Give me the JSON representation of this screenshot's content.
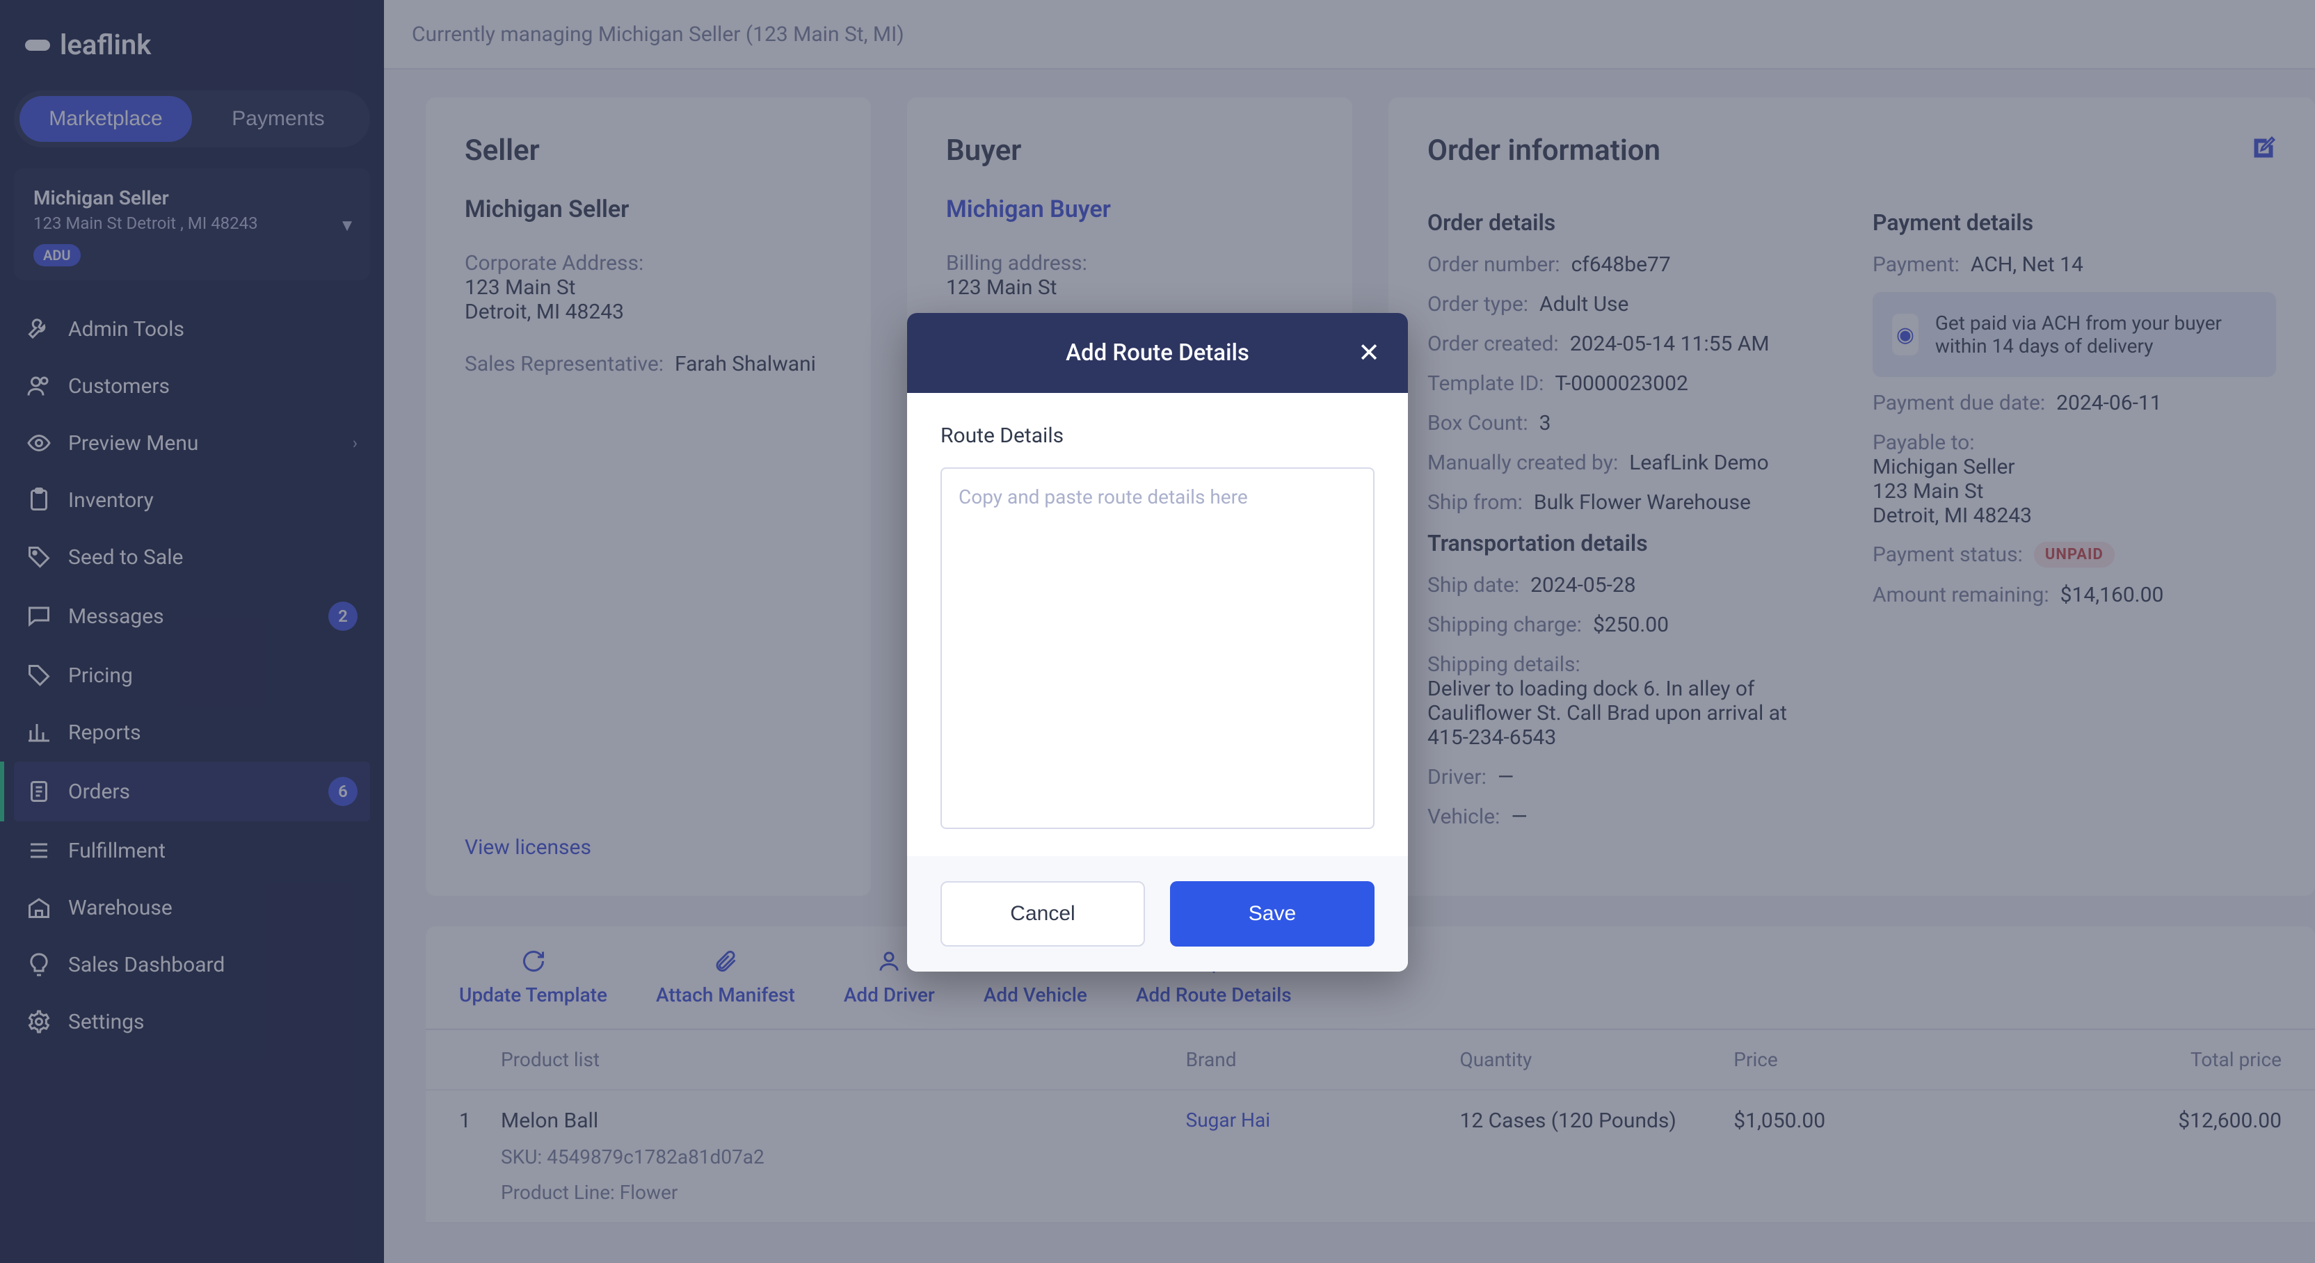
{
  "brand": "leaflink",
  "topbar": {
    "context": "Currently managing Michigan Seller (123 Main St, MI)"
  },
  "segmented": {
    "marketplace": "Marketplace",
    "payments": "Payments"
  },
  "org_card": {
    "name": "Michigan Seller",
    "address": "123 Main St Detroit , MI 48243",
    "badge": "ADU"
  },
  "nav": {
    "admin_tools": "Admin Tools",
    "customers": "Customers",
    "preview_menu": "Preview Menu",
    "inventory": "Inventory",
    "seed_to_sale": "Seed to Sale",
    "messages": "Messages",
    "messages_count": "2",
    "pricing": "Pricing",
    "reports": "Reports",
    "orders": "Orders",
    "orders_count": "6",
    "fulfillment": "Fulfillment",
    "warehouse": "Warehouse",
    "sales_dashboard": "Sales Dashboard",
    "settings": "Settings"
  },
  "seller": {
    "heading": "Seller",
    "company": "Michigan Seller",
    "corp_addr_label": "Corporate Address:",
    "corp_addr_l1": "123 Main St",
    "corp_addr_l2": "Detroit, MI 48243",
    "rep_label": "Sales Representative:",
    "rep_value": "Farah Shalwani",
    "view_licenses": "View licenses"
  },
  "buyer": {
    "heading": "Buyer",
    "company": "Michigan Buyer",
    "bill_addr_label": "Billing address:",
    "bill_addr_l1": "123 Main St"
  },
  "order": {
    "heading": "Order information",
    "details_heading": "Order details",
    "number_label": "Order number:",
    "number_value": "cf648be77",
    "type_label": "Order type:",
    "type_value": "Adult Use",
    "created_label": "Order created:",
    "created_value": "2024-05-14 11:55 AM",
    "template_label": "Template ID:",
    "template_value": "T-0000023002",
    "box_label": "Box Count:",
    "box_value": "3",
    "createdby_label": "Manually created by:",
    "createdby_value": "LeafLink Demo",
    "shipfrom_label": "Ship from:",
    "shipfrom_value": "Bulk Flower Warehouse",
    "transport_heading": "Transportation details",
    "shipdate_label": "Ship date:",
    "shipdate_value": "2024-05-28",
    "shipcharge_label": "Shipping charge:",
    "shipcharge_value": "$250.00",
    "shipdetails_label": "Shipping details:",
    "shipdetails_value": "Deliver to loading dock 6. In alley of Cauliflower St. Call Brad upon arrival at 415-234-6543",
    "driver_label": "Driver:",
    "driver_value": "—",
    "vehicle_label": "Vehicle:",
    "vehicle_value": "—"
  },
  "payment": {
    "heading": "Payment details",
    "method_label": "Payment:",
    "method_value": "ACH, Net 14",
    "promo_text": "Get paid via ACH from your buyer within 14 days of delivery",
    "due_label": "Payment due date:",
    "due_value": "2024-06-11",
    "payable_label": "Payable to:",
    "payable_name": "Michigan Seller",
    "payable_l1": "123 Main St",
    "payable_l2": "Detroit, MI 48243",
    "status_label": "Payment status:",
    "status_badge": "UNPAID",
    "remaining_label": "Amount remaining:",
    "remaining_value": "$14,160.00"
  },
  "actions": {
    "update_template": "Update Template",
    "attach_manifest": "Attach Manifest",
    "add_driver": "Add Driver",
    "add_vehicle": "Add Vehicle",
    "add_route_details": "Add Route Details"
  },
  "table": {
    "h_product": "Product list",
    "h_brand": "Brand",
    "h_qty": "Quantity",
    "h_price": "Price",
    "h_total": "Total price",
    "row1": {
      "idx": "1",
      "name": "Melon Ball",
      "sku": "SKU: 4549879c1782a81d07a2",
      "line": "Product Line: Flower",
      "brand": "Sugar Hai",
      "qty": "12 Cases (120 Pounds)",
      "price": "$1,050.00",
      "total": "$12,600.00"
    }
  },
  "modal": {
    "title": "Add Route Details",
    "field_label": "Route Details",
    "placeholder": "Copy and paste route details here",
    "cancel": "Cancel",
    "save": "Save"
  }
}
